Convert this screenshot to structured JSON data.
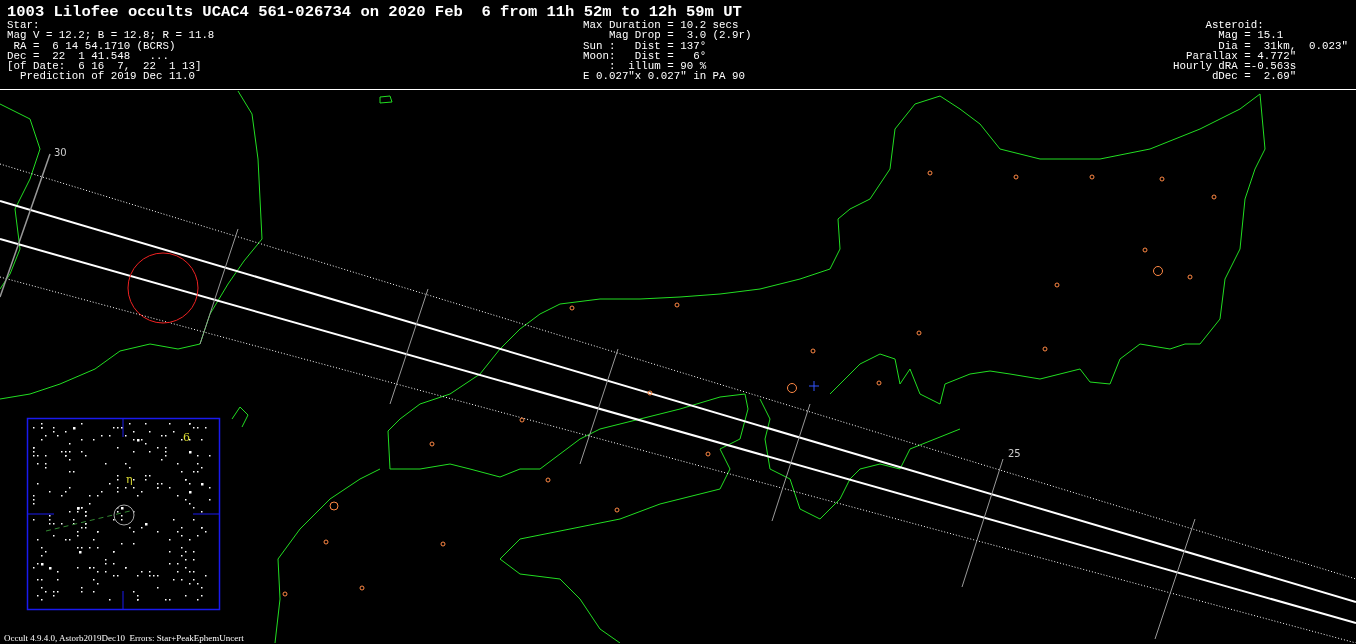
{
  "title": "1003 Lilofee occults UCAC4 561-026734 on 2020 Feb  6 from 11h 52m to 12h 59m UT",
  "star": {
    "lines": [
      "Star:",
      "Mag V = 12.2; B = 12.8; R = 11.8",
      " RA =  6 14 54.1710 (BCRS)",
      "Dec =  22  1 41.548   ...",
      "[of Date:  6 16  7,  22  1 13]",
      "  Prediction of 2019 Dec 11.0"
    ]
  },
  "event": {
    "lines": [
      "Max Duration = 10.2 secs",
      "    Mag Drop =  3.0 (2.9r)",
      "Sun :   Dist = 137°",
      "Moon:   Dist =   6°",
      "    :  illum = 90 %",
      "E 0.027\"x 0.027\" in PA 90"
    ]
  },
  "asteroid": {
    "lines": [
      "     Asteroid:",
      "       Mag = 15.1",
      "       Dia =  31km,  0.023\"",
      "  Parallax = 4.772\"",
      "Hourly dRA =-0.563s",
      "      dDec =  2.69\""
    ]
  },
  "map": {
    "time_labels": [
      "30",
      "25"
    ]
  },
  "finder": {
    "labels": [
      "6",
      "η"
    ]
  },
  "footer": "Occult 4.9.4.0, Astorb2019Dec10  Errors: Star+PeakEphemUncert"
}
